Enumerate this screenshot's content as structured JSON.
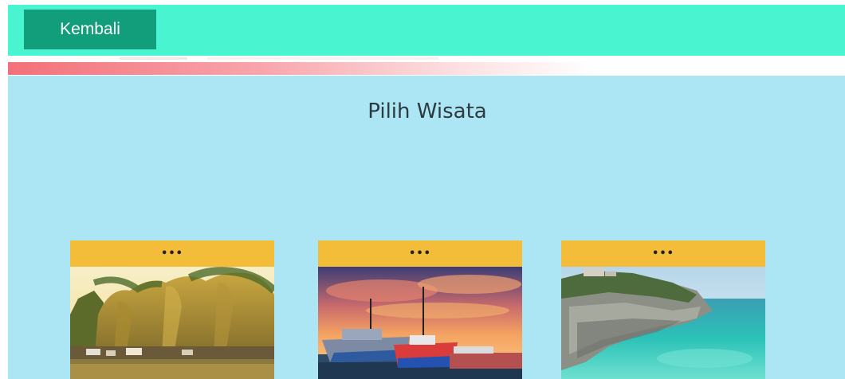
{
  "header": {
    "back_label": "Kembali"
  },
  "main": {
    "title": "Pilih Wisata",
    "cards": [
      {
        "header_label": "•••"
      },
      {
        "header_label": "•••"
      },
      {
        "header_label": "•••"
      }
    ]
  },
  "colors": {
    "topbar": "#48f5d0",
    "back_button": "#139e7b",
    "background": "#ace6f4",
    "card_header": "#f3bd3a"
  }
}
